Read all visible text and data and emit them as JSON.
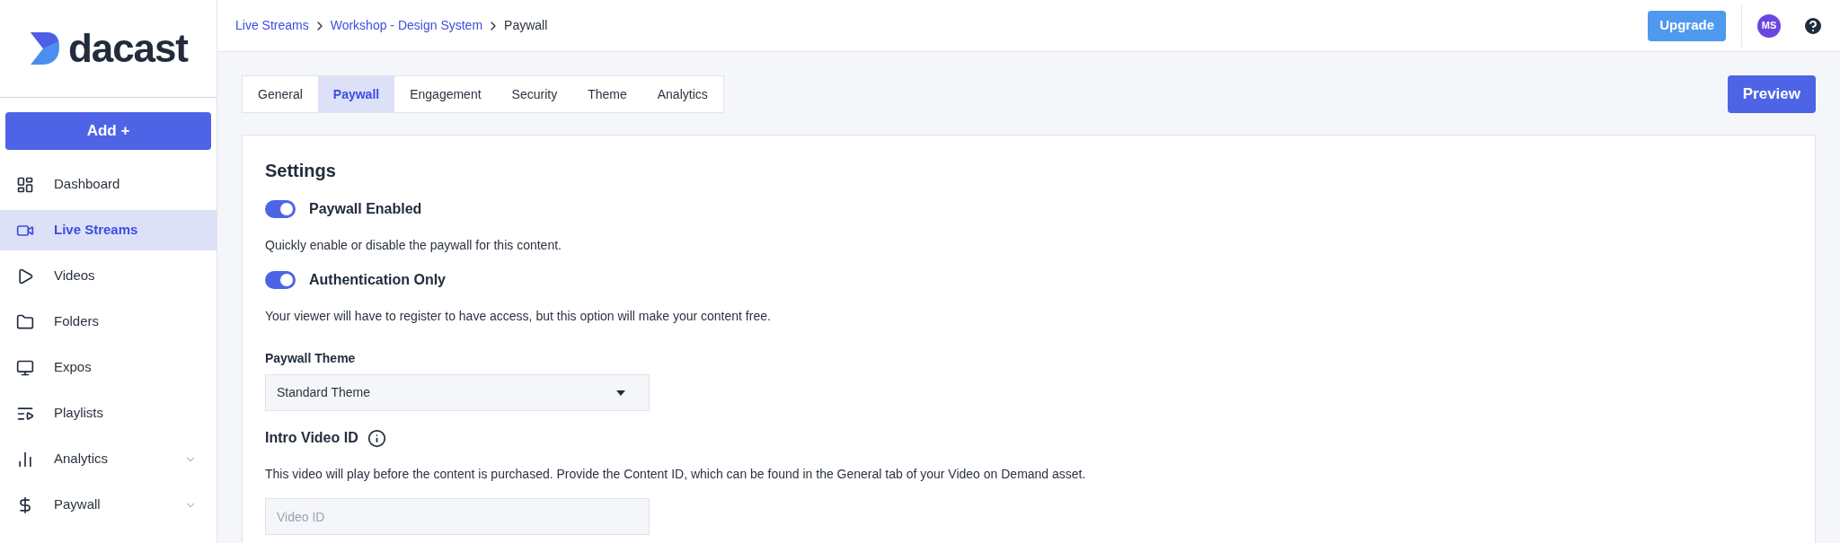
{
  "logo": {
    "text": "dacast"
  },
  "add_button": {
    "label": "Add +"
  },
  "sidebar": {
    "items": [
      {
        "label": "Dashboard",
        "selected": false,
        "kind": "link"
      },
      {
        "label": "Live Streams",
        "selected": true,
        "kind": "link"
      },
      {
        "label": "Videos",
        "selected": false,
        "kind": "link"
      },
      {
        "label": "Folders",
        "selected": false,
        "kind": "link"
      },
      {
        "label": "Expos",
        "selected": false,
        "kind": "link"
      },
      {
        "label": "Playlists",
        "selected": false,
        "kind": "link"
      },
      {
        "label": "Analytics",
        "selected": false,
        "kind": "group"
      },
      {
        "label": "Paywall",
        "selected": false,
        "kind": "group"
      }
    ]
  },
  "breadcrumb": [
    {
      "label": "Live Streams",
      "kind": "link"
    },
    {
      "label": "Workshop - Design System",
      "kind": "link"
    },
    {
      "label": "Paywall",
      "kind": "current"
    }
  ],
  "header": {
    "upgrade": "Upgrade",
    "avatar": "MS"
  },
  "tabs": [
    {
      "label": "General",
      "selected": false
    },
    {
      "label": "Paywall",
      "selected": true
    },
    {
      "label": "Engagement",
      "selected": false
    },
    {
      "label": "Security",
      "selected": false
    },
    {
      "label": "Theme",
      "selected": false
    },
    {
      "label": "Analytics",
      "selected": false
    }
  ],
  "preview_button": "Preview",
  "settings": {
    "title": "Settings",
    "toggles": [
      {
        "label": "Paywall Enabled",
        "on": true,
        "description": "Quickly enable or disable the paywall for this content."
      },
      {
        "label": "Authentication Only",
        "on": true,
        "description": "Your viewer will have to register to have access, but this option will make your content free."
      }
    ],
    "theme": {
      "label": "Paywall Theme",
      "value": "Standard Theme"
    },
    "intro_video": {
      "label": "Intro Video ID",
      "description": "This video will play before the content is purchased. Provide the Content ID, which can be found in the General tab of your Video on Demand asset.",
      "placeholder": "Video ID"
    }
  }
}
